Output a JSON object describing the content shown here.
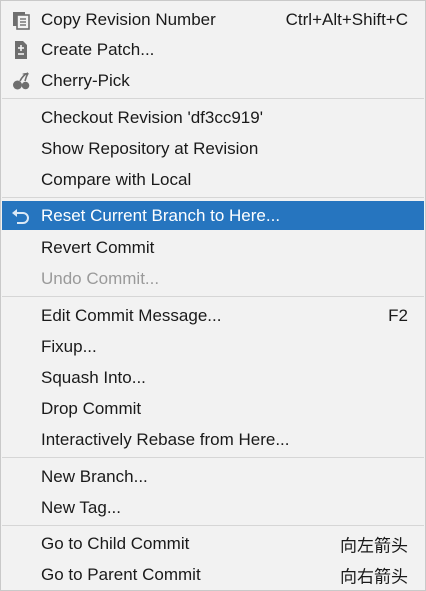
{
  "menu": {
    "items": [
      {
        "label": "Copy Revision Number",
        "shortcut": "Ctrl+Alt+Shift+C",
        "icon": "copy-icon"
      },
      {
        "label": "Create Patch...",
        "shortcut": "",
        "icon": "patch-icon"
      },
      {
        "label": "Cherry-Pick",
        "shortcut": "",
        "icon": "cherry-icon"
      },
      {
        "label": "Checkout Revision 'df3cc919'",
        "shortcut": ""
      },
      {
        "label": "Show Repository at Revision",
        "shortcut": ""
      },
      {
        "label": "Compare with Local",
        "shortcut": ""
      },
      {
        "label": "Reset Current Branch to Here...",
        "shortcut": "",
        "icon": "undo-arrow-icon",
        "selected": true
      },
      {
        "label": "Revert Commit",
        "shortcut": ""
      },
      {
        "label": "Undo Commit...",
        "shortcut": "",
        "disabled": true
      },
      {
        "label": "Edit Commit Message...",
        "shortcut": "F2"
      },
      {
        "label": "Fixup...",
        "shortcut": ""
      },
      {
        "label": "Squash Into...",
        "shortcut": ""
      },
      {
        "label": "Drop Commit",
        "shortcut": ""
      },
      {
        "label": "Interactively Rebase from Here...",
        "shortcut": ""
      },
      {
        "label": "New Branch...",
        "shortcut": ""
      },
      {
        "label": "New Tag...",
        "shortcut": ""
      },
      {
        "label": "Go to Child Commit",
        "shortcut": "向左箭头"
      },
      {
        "label": "Go to Parent Commit",
        "shortcut": "向右箭头"
      }
    ]
  },
  "colors": {
    "menu_background": "#f2f2f2",
    "selection": "#2675bf",
    "text": "#1a1a1a",
    "disabled_text": "#9a9a9a",
    "icon_gray": "#6e6e6e"
  }
}
